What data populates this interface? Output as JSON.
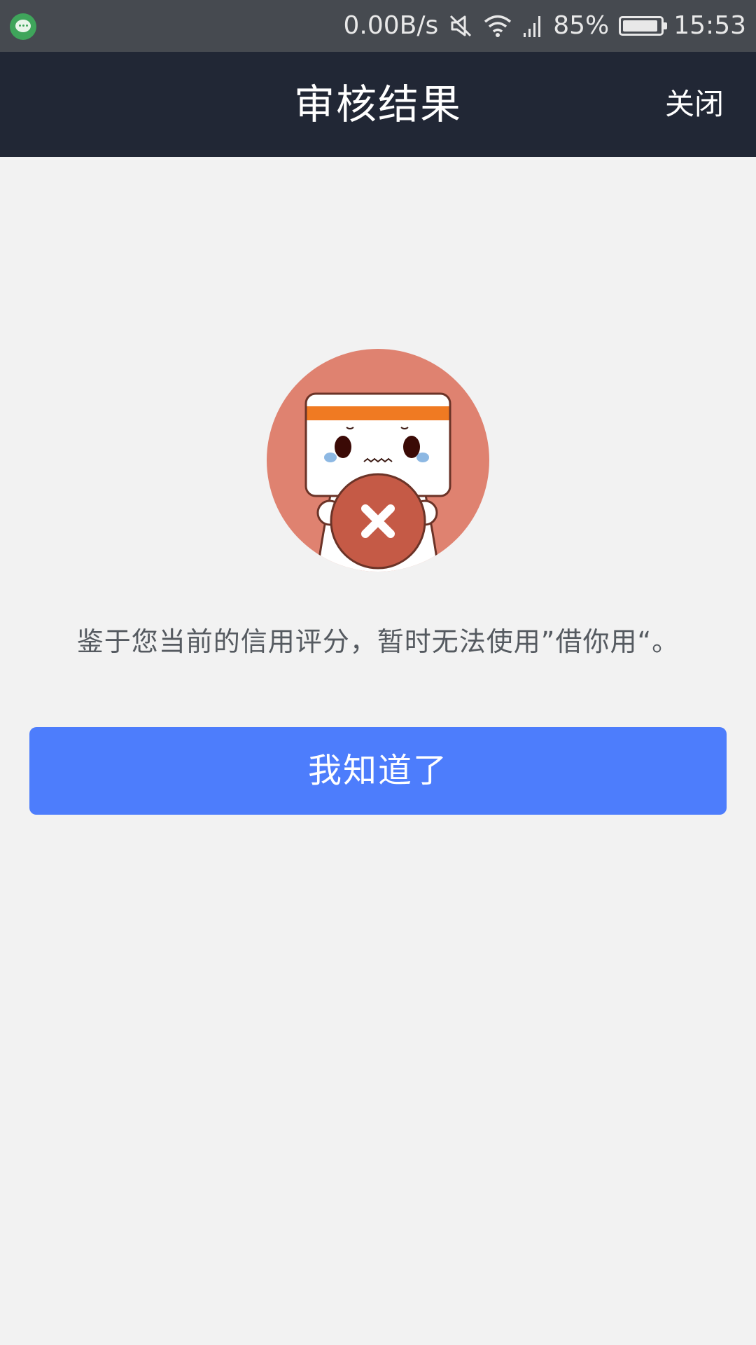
{
  "status_bar": {
    "network_speed": "0.00B/s",
    "battery_percent": "85%",
    "time": "15:53",
    "icons": [
      "chat-app-icon",
      "mute-icon",
      "wifi-icon",
      "signal-icon",
      "battery-icon"
    ]
  },
  "nav": {
    "title": "审核结果",
    "close_label": "关闭"
  },
  "result": {
    "illustration": "rejected-mascot-illustration",
    "message": "鉴于您当前的信用评分，暂时无法使用”借你用“。",
    "confirm_label": "我知道了"
  },
  "colors": {
    "nav_bg": "#212735",
    "status_bg": "#464a50",
    "page_bg": "#f2f2f2",
    "button_bg": "#4d7dfc",
    "illustration_circle": "#df8270",
    "reject_badge": "#c55a46",
    "headband": "#f07a22"
  }
}
